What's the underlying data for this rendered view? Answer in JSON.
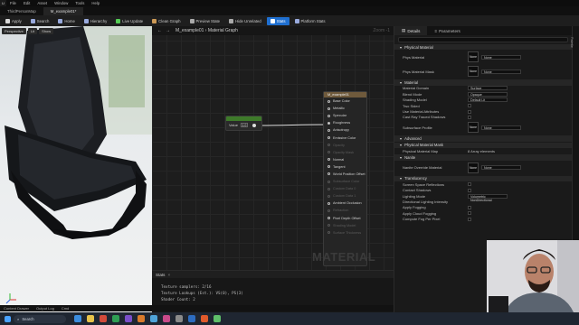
{
  "menu": {
    "logo": "U",
    "items": [
      "File",
      "Edit",
      "Asset",
      "Window",
      "Tools",
      "Help"
    ]
  },
  "tabs": [
    {
      "label": "ThirdPersonMap",
      "active": false
    },
    {
      "label": "M_example01*",
      "active": true
    }
  ],
  "toolbar": {
    "buttons": [
      {
        "label": "Apply",
        "icon": "save-icon",
        "color": "#d8d8d8"
      },
      {
        "label": "Search",
        "icon": "search-icon",
        "color": "#9ad"
      },
      {
        "label": "Home",
        "icon": "home-icon",
        "color": "#9ad"
      },
      {
        "label": "Hierarchy",
        "icon": "hierarchy-icon",
        "color": "#9ad"
      },
      {
        "label": "Live Update",
        "icon": "live-update-icon",
        "color": "#5c5"
      },
      {
        "label": "Clean Graph",
        "icon": "clean-graph-icon",
        "color": "#c95"
      },
      {
        "label": "Preview State",
        "icon": "preview-icon",
        "color": "#aaa"
      },
      {
        "label": "Hide Unrelated",
        "icon": "hide-unrelated-icon",
        "color": "#aaa"
      },
      {
        "label": "Stats",
        "icon": "stats-icon",
        "color": "#fff",
        "selected": true
      },
      {
        "label": "Platform Stats",
        "icon": "platform-stats-icon",
        "color": "#9ad"
      }
    ]
  },
  "viewport": {
    "buttons": [
      "Perspective",
      "Lit",
      "Show"
    ]
  },
  "graph": {
    "breadcrumb": "M_example01 › Material Graph",
    "zoom": "Zoom -1",
    "watermark": "MATERIAL",
    "scalar_node": {
      "label": "Value",
      "value": "1.0"
    },
    "result_node": {
      "title": "M_example01",
      "pins": [
        {
          "label": "Base Color",
          "state": "normal"
        },
        {
          "label": "Metallic",
          "state": "normal"
        },
        {
          "label": "Specular",
          "state": "normal"
        },
        {
          "label": "Roughness",
          "state": "connected"
        },
        {
          "label": "Anisotropy",
          "state": "normal"
        },
        {
          "label": "Emissive Color",
          "state": "normal"
        },
        {
          "label": "Opacity",
          "state": "dim"
        },
        {
          "label": "Opacity Mask",
          "state": "dim"
        },
        {
          "label": "Normal",
          "state": "normal"
        },
        {
          "label": "Tangent",
          "state": "normal"
        },
        {
          "label": "World Position Offset",
          "state": "normal"
        },
        {
          "label": "Subsurface Color",
          "state": "dim"
        },
        {
          "label": "Custom Data 0",
          "state": "dim"
        },
        {
          "label": "Custom Data 1",
          "state": "dim"
        },
        {
          "label": "Ambient Occlusion",
          "state": "normal"
        },
        {
          "label": "Refraction",
          "state": "dim"
        },
        {
          "label": "Pixel Depth Offset",
          "state": "normal"
        },
        {
          "label": "Shading Model",
          "state": "dim"
        },
        {
          "label": "Surface Thickness",
          "state": "dim"
        }
      ]
    }
  },
  "stats": {
    "title": "Stats",
    "lines": [
      "Texture samplers: 2/16",
      "Texture Lookups (Est.): VS(0), PS(3)",
      "Shader Count: 2"
    ]
  },
  "details": {
    "tabs": [
      "Details",
      "Parameters"
    ],
    "sections": [
      {
        "title": "Physical Material",
        "rows": [
          {
            "name": "Phys Material",
            "kind": "asset",
            "value": "None"
          },
          {
            "name": "Phys Material Mask",
            "kind": "asset",
            "value": "None"
          }
        ]
      },
      {
        "title": "Material",
        "rows": [
          {
            "name": "Material Domain",
            "kind": "combo",
            "value": "Surface"
          },
          {
            "name": "Blend Mode",
            "kind": "combo",
            "value": "Opaque"
          },
          {
            "name": "Shading Model",
            "kind": "combo",
            "value": "Default Lit"
          },
          {
            "name": "Two Sided",
            "kind": "check",
            "value": ""
          },
          {
            "name": "Use Material Attributes",
            "kind": "check",
            "value": ""
          },
          {
            "name": "Cast Ray Traced Shadows",
            "kind": "check",
            "value": ""
          },
          {
            "name": "Subsurface Profile",
            "kind": "asset",
            "value": "None"
          }
        ]
      },
      {
        "title": "Advanced",
        "rows": []
      },
      {
        "title": "Physical Material Mask",
        "rows": [
          {
            "name": "Physical Material Map",
            "kind": "text",
            "value": "8 Array elements"
          }
        ]
      },
      {
        "title": "Nanite",
        "rows": [
          {
            "name": "Nanite Override Material",
            "kind": "asset",
            "value": "None"
          }
        ]
      },
      {
        "title": "Translucency",
        "rows": [
          {
            "name": "Screen Space Reflections",
            "kind": "check",
            "value": ""
          },
          {
            "name": "Contact Shadows",
            "kind": "check",
            "value": ""
          },
          {
            "name": "Lighting Mode",
            "kind": "combo",
            "value": "Volumetric NonDirectional"
          },
          {
            "name": "Directional Lighting Intensity",
            "kind": "text",
            "value": ""
          },
          {
            "name": "Apply Fogging",
            "kind": "check",
            "value": ""
          },
          {
            "name": "Apply Cloud Fogging",
            "kind": "check",
            "value": ""
          },
          {
            "name": "Compute Fog Per Pixel",
            "kind": "check",
            "value": ""
          }
        ]
      }
    ]
  },
  "right_strip": {
    "label": "Palette"
  },
  "statusbar": {
    "items": [
      "Content Drawer",
      "Output Log",
      "Cmd"
    ]
  },
  "taskbar": {
    "search": "Search",
    "icons": [
      "#3c8dde",
      "#e8c34a",
      "#d24a3a",
      "#2f9e54",
      "#7b4fc9",
      "#d97a2b",
      "#4fa3d9",
      "#c94a8a",
      "#8a8a8a",
      "#2d6cc0",
      "#e05a2b",
      "#5fbf6a"
    ]
  }
}
